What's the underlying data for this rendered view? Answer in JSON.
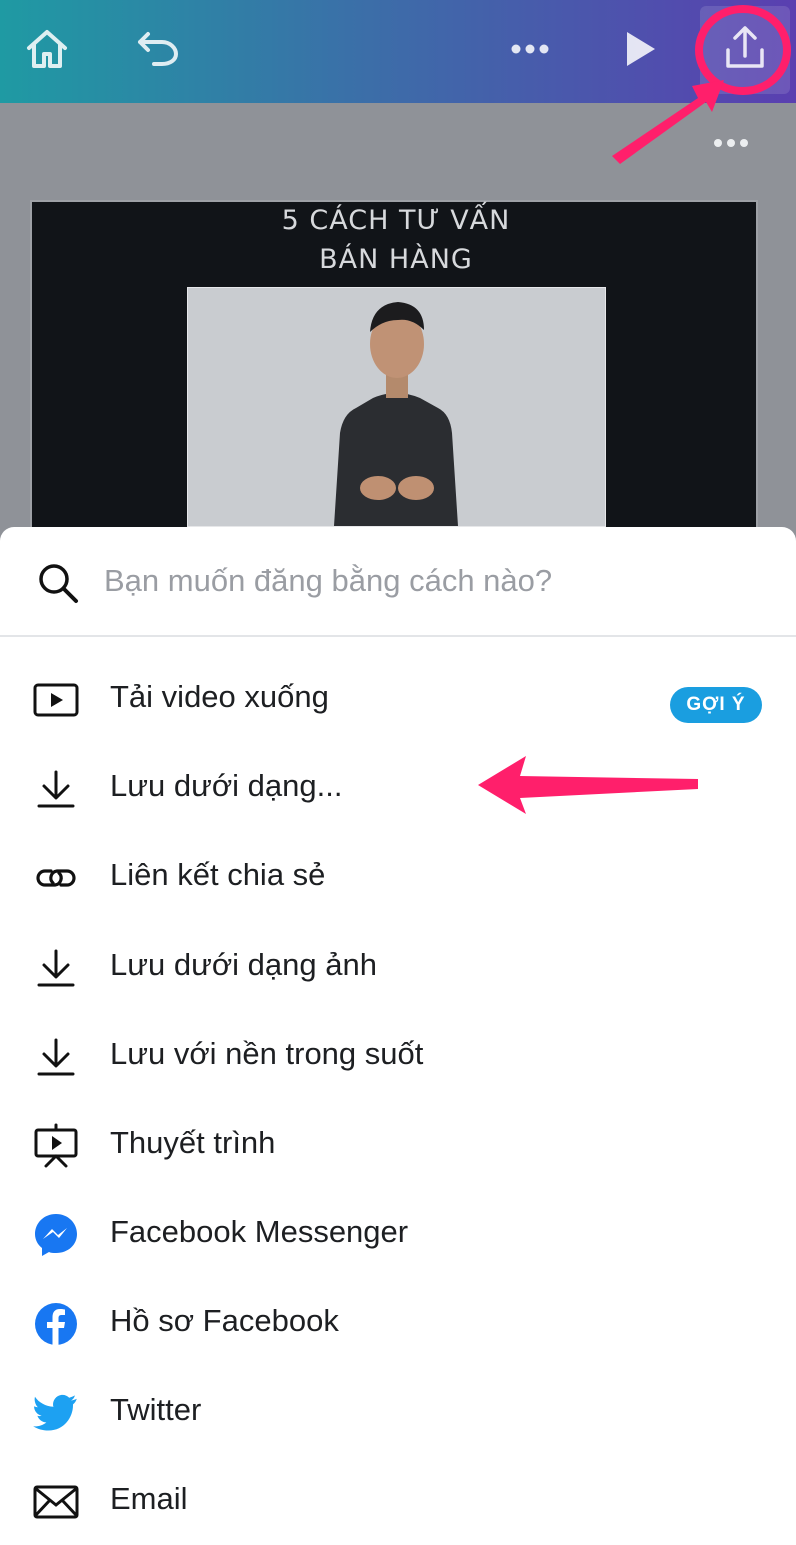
{
  "toolbar": {
    "home_icon": "home-icon",
    "undo_icon": "undo-icon",
    "more_icon": "more-horizontal-icon",
    "play_icon": "play-icon",
    "share_icon": "share-upload-icon"
  },
  "canvas": {
    "slide_title_line1": "5 CÁCH TƯ VẤN",
    "slide_title_line2": "BÁN HÀNG"
  },
  "share_sheet": {
    "search": {
      "placeholder": "Bạn muốn đăng bằng cách nào?",
      "value": ""
    },
    "items": [
      {
        "label": "Tải video xuống",
        "icon": "video-download-icon",
        "badge": "GỢI Ý"
      },
      {
        "label": "Lưu dưới dạng...",
        "icon": "download-icon"
      },
      {
        "label": "Liên kết chia sẻ",
        "icon": "link-icon"
      },
      {
        "label": "Lưu dưới dạng ảnh",
        "icon": "download-icon"
      },
      {
        "label": "Lưu với nền trong suốt",
        "icon": "download-icon"
      },
      {
        "label": "Thuyết trình",
        "icon": "presentation-icon"
      },
      {
        "label": "Facebook Messenger",
        "icon": "messenger-icon"
      },
      {
        "label": "Hồ sơ Facebook",
        "icon": "facebook-icon"
      },
      {
        "label": "Twitter",
        "icon": "twitter-icon"
      },
      {
        "label": "Email",
        "icon": "email-icon"
      }
    ]
  },
  "colors": {
    "annotation_pink": "#ff1f6b",
    "badge_blue": "#1a9ee0",
    "messenger_blue": "#1877f2",
    "twitter_blue": "#1da1f2"
  }
}
